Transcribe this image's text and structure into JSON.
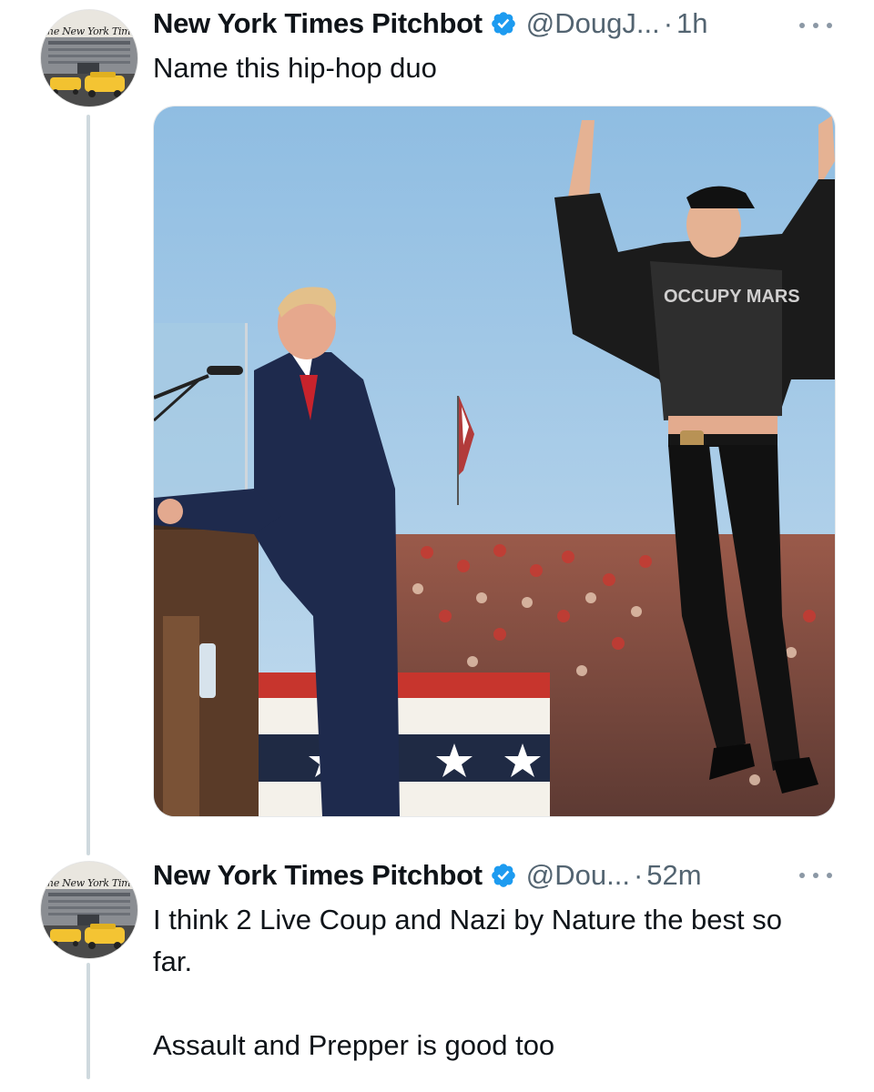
{
  "thread": {
    "tweets": [
      {
        "display_name": "New York Times Pitchbot",
        "verified": true,
        "handle": "@DougJ...",
        "separator": "·",
        "time": "1h",
        "text": "Name this hip-hop duo",
        "avatar": {
          "wordmark": "The New York Times",
          "icon": "nyt-building-avatar"
        },
        "media": {
          "icon": "rally-photo",
          "shirt_text": "OCCUPY MARS"
        }
      },
      {
        "display_name": "New York Times Pitchbot",
        "verified": true,
        "handle": "@Dou...",
        "separator": "·",
        "time": "52m",
        "text_line_1": "I think 2 Live Coup and Nazi by Nature the best so far.",
        "text_line_2": "Assault and Prepper is good too",
        "avatar": {
          "wordmark": "The New York Times",
          "icon": "nyt-building-avatar"
        }
      }
    ]
  },
  "colors": {
    "verified_badge": "#1d9bf0",
    "secondary_text": "#536471",
    "thread_line": "#cfd9de",
    "primary_text": "#0f1419"
  }
}
